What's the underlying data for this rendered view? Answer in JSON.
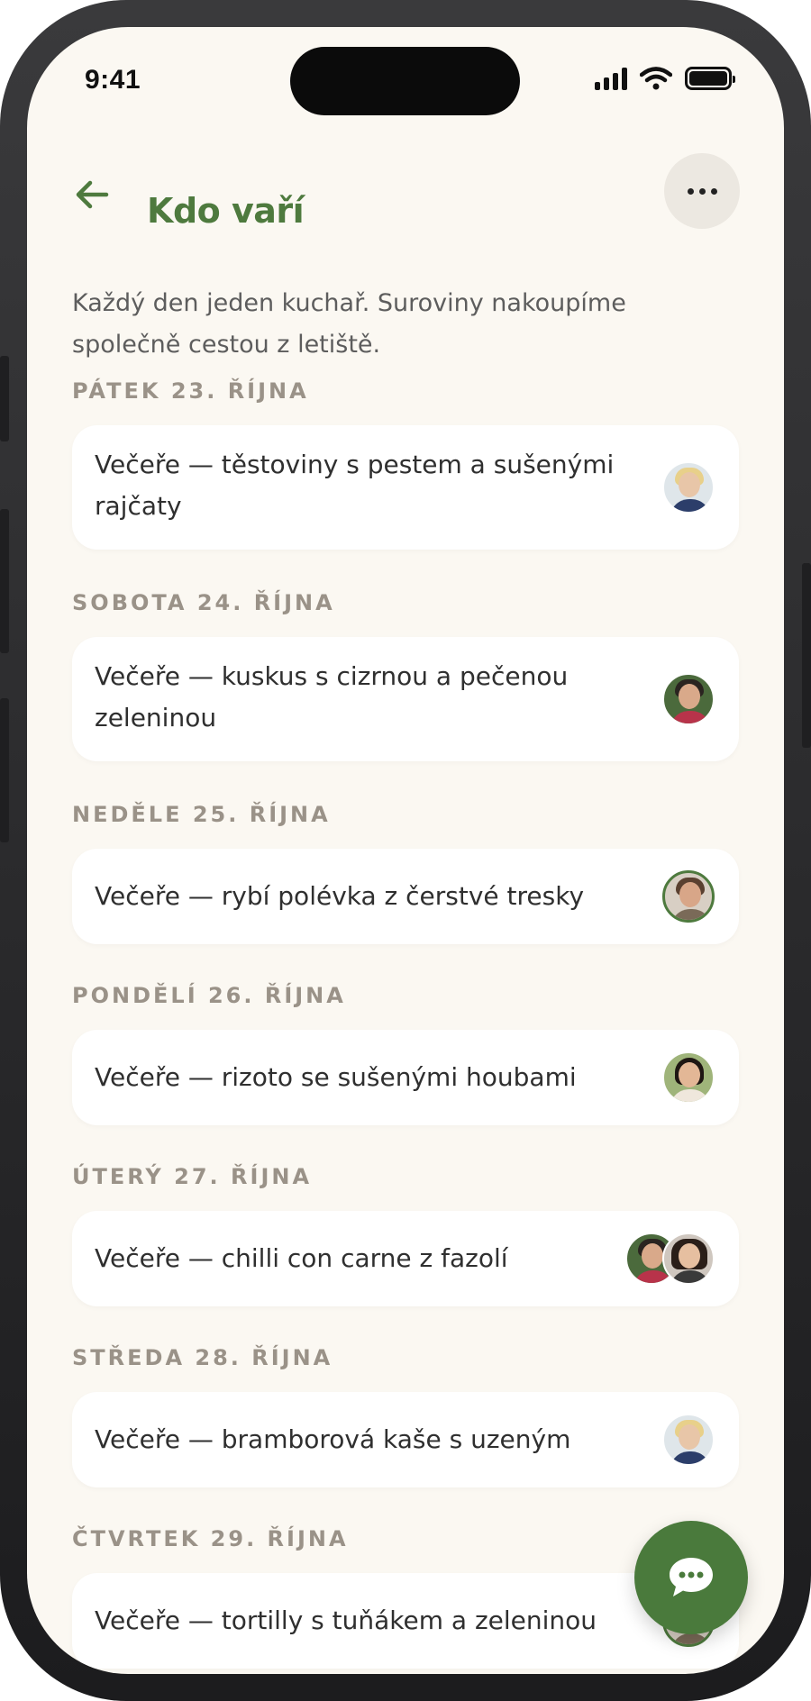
{
  "status_bar": {
    "time": "9:41"
  },
  "header": {
    "title": "Kdo vaří",
    "back_icon": "arrow-left-icon",
    "more_icon": "ellipsis-icon"
  },
  "intro": "Každý den jeden kuchař. Suroviny nakoupíme společně cestou z letiště.",
  "days": [
    {
      "label": "PÁTEK 23. ŘÍJNA",
      "meal_line1": "Večeře — těstoviny s pestem a sušenými",
      "meal_line2": "rajčaty",
      "cooks": [
        "avatar-woman-blonde"
      ]
    },
    {
      "label": "SOBOTA 24. ŘÍJNA",
      "meal_line1": "Večeře — kuskus s cizrnou a pečenou",
      "meal_line2": "zeleninou",
      "cooks": [
        "avatar-man-dark-hair"
      ]
    },
    {
      "label": "NEDĚLE 25. ŘÍJNA",
      "meal_line1": "Večeře — rybí polévka z čerstvé tresky",
      "meal_line2": "",
      "cooks": [
        "avatar-man-beard"
      ]
    },
    {
      "label": "PONDĚLÍ 26. ŘÍJNA",
      "meal_line1": "Večeře — rizoto se sušenými houbami",
      "meal_line2": "",
      "cooks": [
        "avatar-woman-dark-hair"
      ]
    },
    {
      "label": "ÚTERÝ 27. ŘÍJNA",
      "meal_line1": "Večeře — chilli con carne z fazolí",
      "meal_line2": "",
      "cooks": [
        "avatar-man-dark-hair",
        "avatar-woman-curly"
      ]
    },
    {
      "label": "STŘEDA 28. ŘÍJNA",
      "meal_line1": "Večeře — bramborová kaše s uzeným",
      "meal_line2": "",
      "cooks": [
        "avatar-woman-blonde"
      ]
    },
    {
      "label": "ČTVRTEK 29. ŘÍJNA",
      "meal_line1": "Večeře — tortilly s tuňákem a zeleninou",
      "meal_line2": "",
      "cooks": [
        "avatar-man-beard"
      ]
    }
  ],
  "fab": {
    "icon": "chat-bubble-icon"
  },
  "colors": {
    "accent": "#4e7a3e",
    "background": "#fbf8f2",
    "card": "#ffffff",
    "day_label": "#9a9288"
  }
}
